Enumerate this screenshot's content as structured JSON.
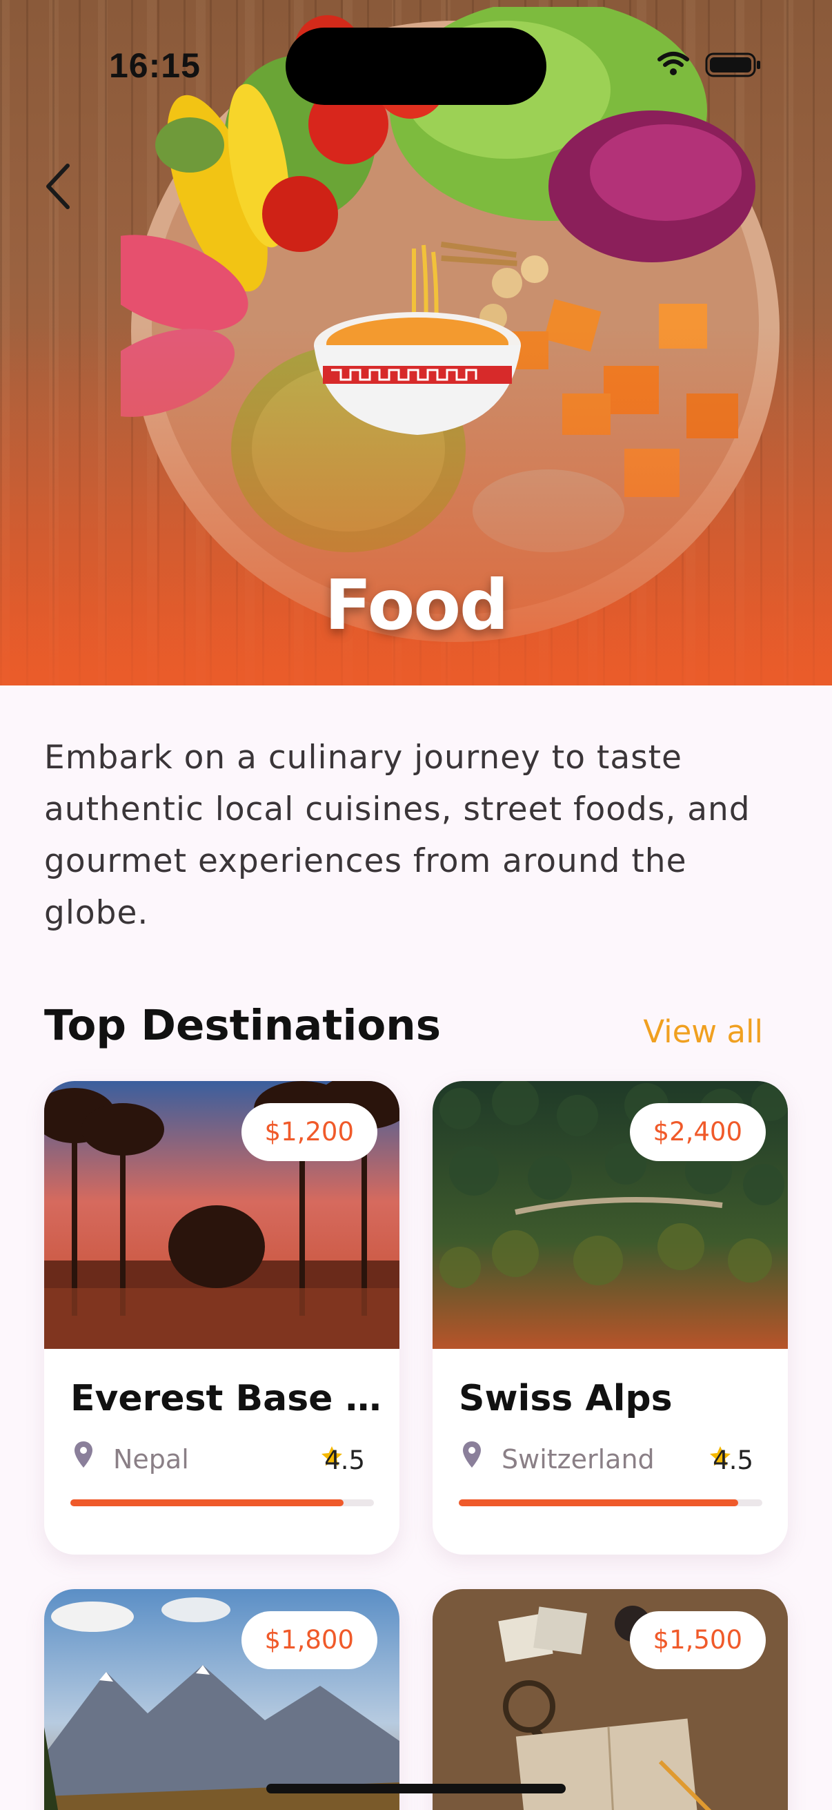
{
  "status_bar": {
    "time": "16:15"
  },
  "hero": {
    "title": "Food",
    "emoji_icon": "noodle-bowl-icon"
  },
  "description": "Embark on a culinary journey to taste authentic local cuisines, street foods, and gourmet experiences from around the globe.",
  "section": {
    "title": "Top Destinations",
    "view_all": "View all"
  },
  "colors": {
    "accent": "#ef5a2b",
    "view_all": "#f0a020",
    "star": "#f5b800",
    "background": "#fdf7fc"
  },
  "cards": [
    {
      "price": "$1,200",
      "title": "Everest Base Ca...",
      "location": "Nepal",
      "rating": "4.5",
      "progress": 0.9,
      "image": "palm-sunset"
    },
    {
      "price": "$2,400",
      "title": "Swiss Alps",
      "location": "Switzerland",
      "rating": "4.5",
      "progress": 0.92,
      "image": "forest-aerial"
    },
    {
      "price": "$1,800",
      "title": "",
      "location": "",
      "rating": "",
      "progress": 0,
      "image": "mountains"
    },
    {
      "price": "$1,500",
      "title": "",
      "location": "",
      "rating": "",
      "progress": 0,
      "image": "map-desk"
    }
  ]
}
